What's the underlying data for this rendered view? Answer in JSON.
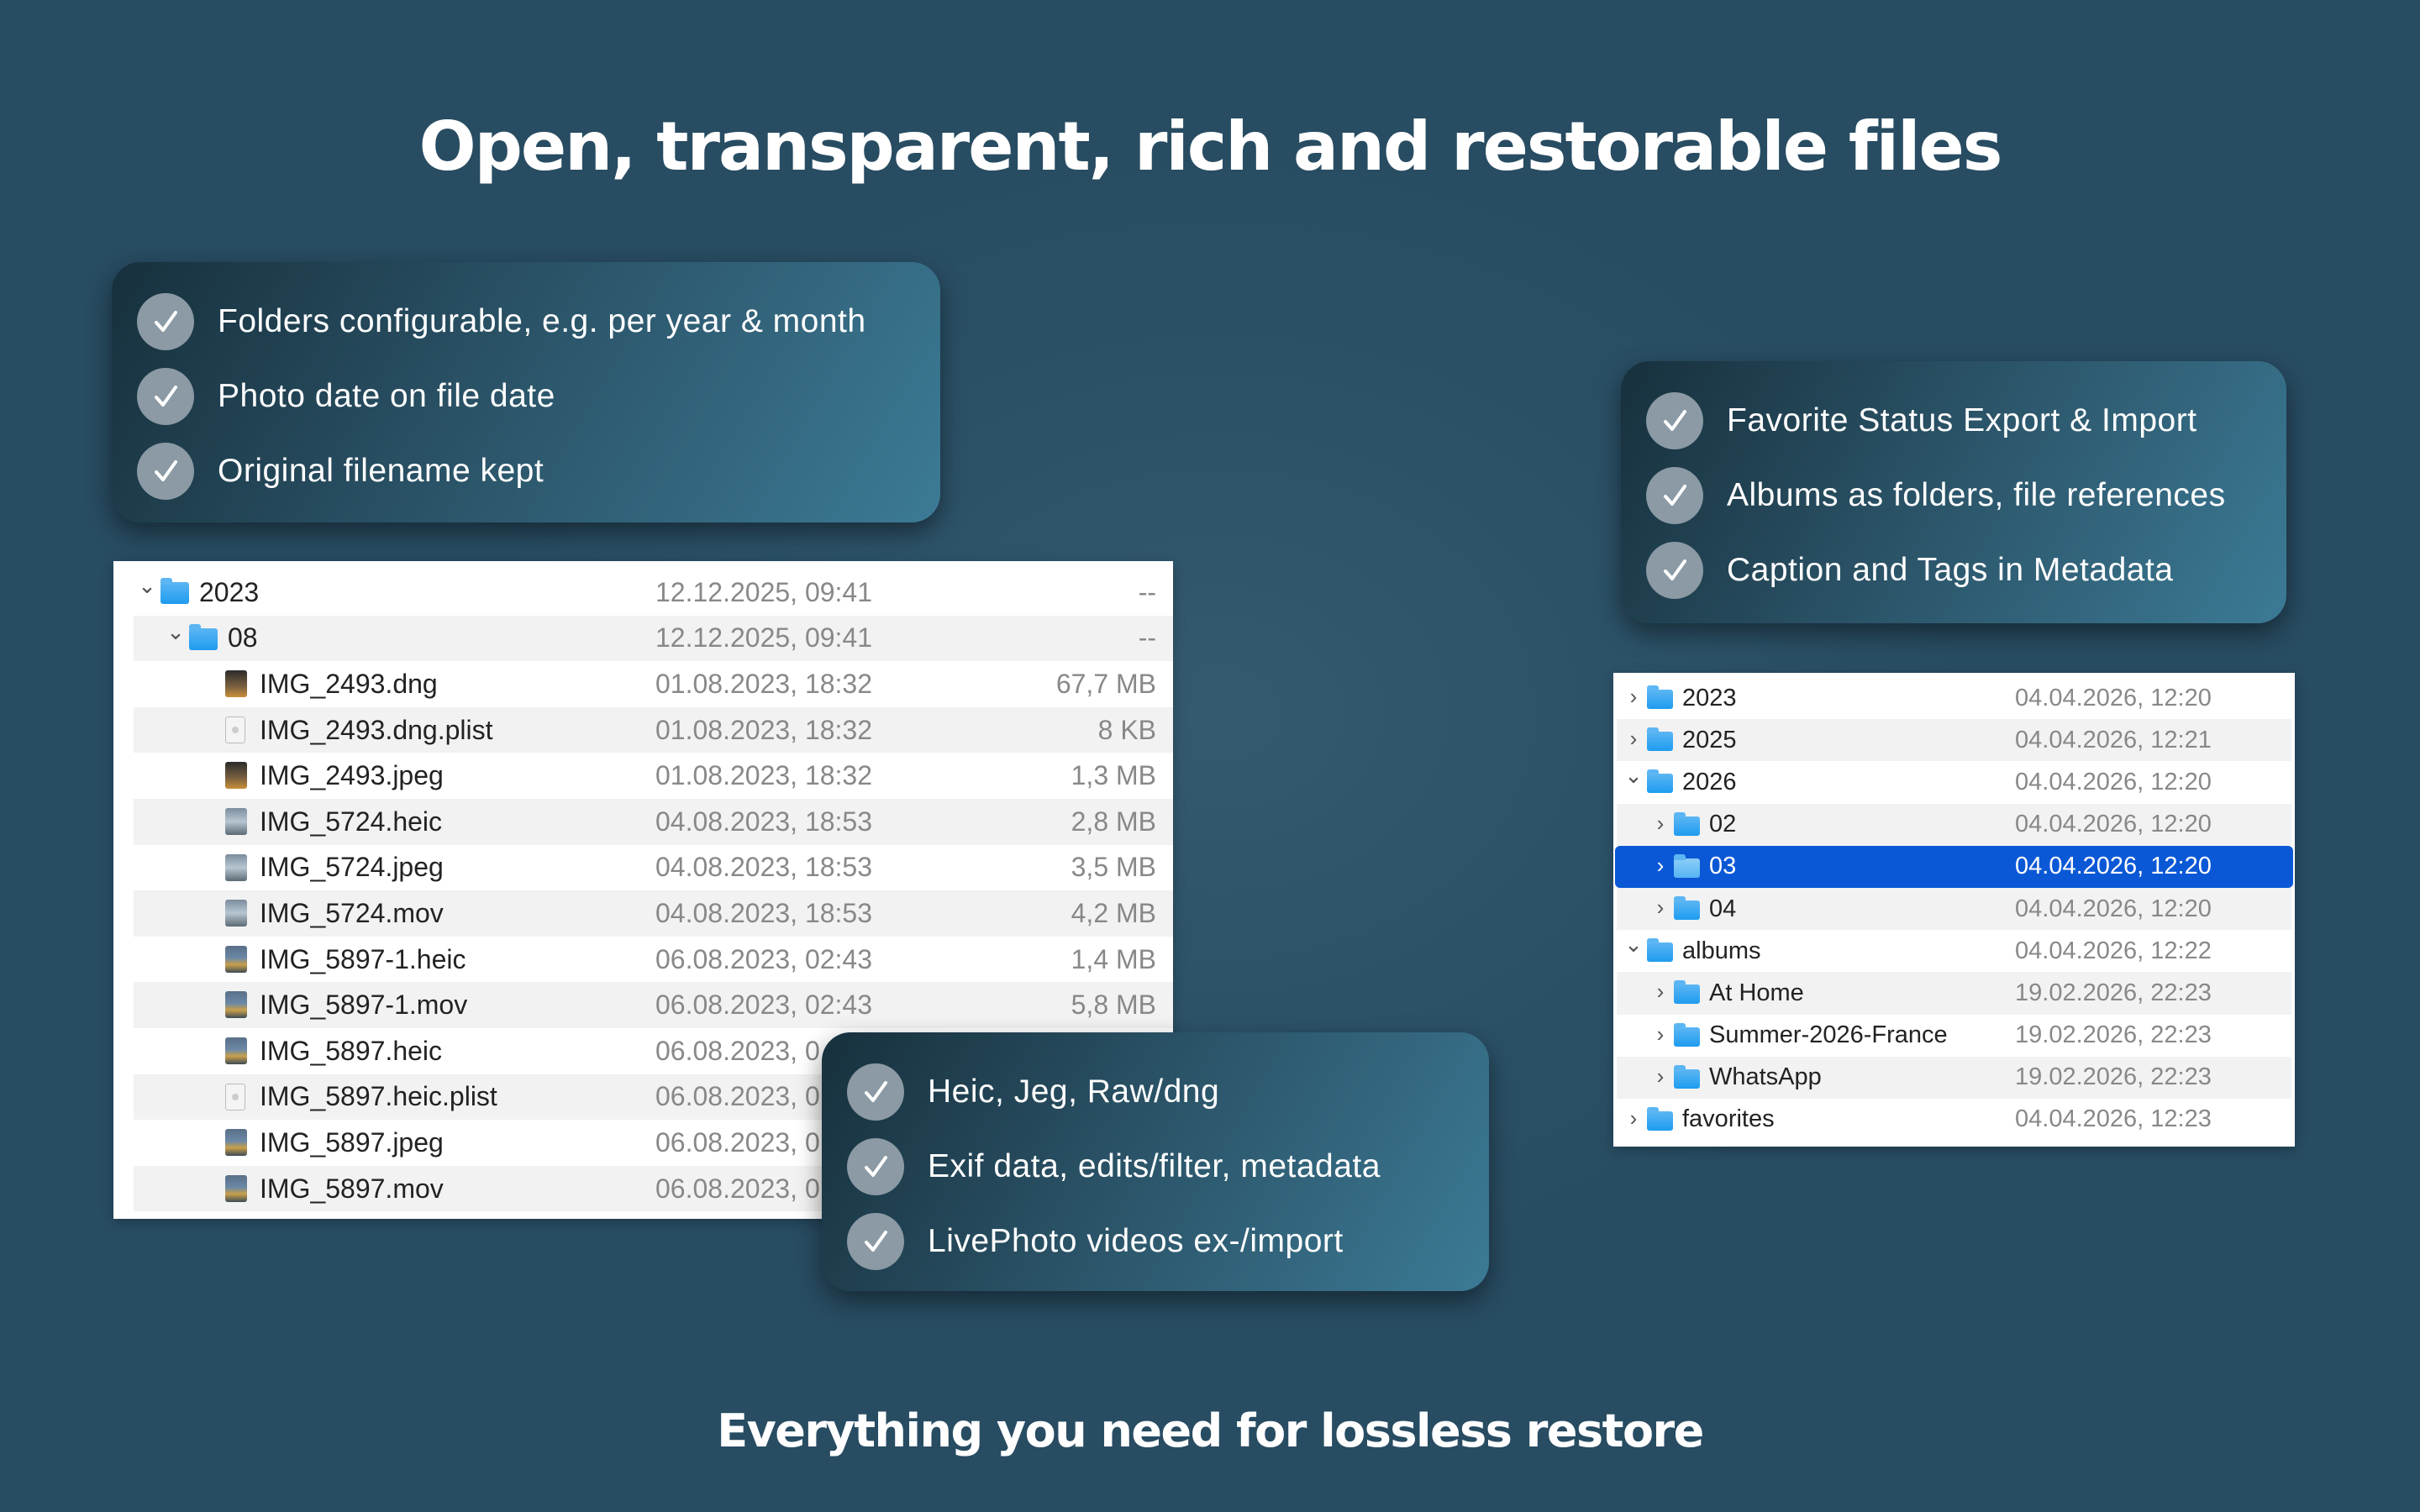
{
  "title": "Open, transparent, rich and restorable files",
  "subtitle": "Everything you need for lossless restore",
  "features_top_left": [
    "Folders configurable, e.g. per year & month",
    "Photo date on file date",
    "Original filename kept"
  ],
  "features_top_right": [
    "Favorite Status Export & Import",
    "Albums as folders, file references",
    "Caption and Tags in Metadata"
  ],
  "features_bottom_mid": [
    "Heic, Jeg, Raw/dng",
    " Exif data, edits/filter, metadata",
    "LivePhoto videos ex-/import"
  ],
  "finder_left": {
    "rows": [
      {
        "name": "2023",
        "date": "12.12.2025, 09:41",
        "size": "--",
        "kind": "folder",
        "depth": 0,
        "expanded": true
      },
      {
        "name": "08",
        "date": "12.12.2025, 09:41",
        "size": "--",
        "kind": "folder",
        "depth": 1,
        "expanded": true
      },
      {
        "name": "IMG_2493.dng",
        "date": "01.08.2023, 18:32",
        "size": "67,7 MB",
        "kind": "raw",
        "depth": 2
      },
      {
        "name": "IMG_2493.dng.plist",
        "date": "01.08.2023, 18:32",
        "size": "8 KB",
        "kind": "plist",
        "depth": 2
      },
      {
        "name": "IMG_2493.jpeg",
        "date": "01.08.2023, 18:32",
        "size": "1,3 MB",
        "kind": "raw",
        "depth": 2
      },
      {
        "name": "IMG_5724.heic",
        "date": "04.08.2023, 18:53",
        "size": "2,8 MB",
        "kind": "live",
        "depth": 2
      },
      {
        "name": "IMG_5724.jpeg",
        "date": "04.08.2023, 18:53",
        "size": "3,5 MB",
        "kind": "live",
        "depth": 2
      },
      {
        "name": "IMG_5724.mov",
        "date": "04.08.2023, 18:53",
        "size": "4,2 MB",
        "kind": "live",
        "depth": 2
      },
      {
        "name": "IMG_5897-1.heic",
        "date": "06.08.2023, 02:43",
        "size": "1,4 MB",
        "kind": "photo",
        "depth": 2
      },
      {
        "name": "IMG_5897-1.mov",
        "date": "06.08.2023, 02:43",
        "size": "5,8 MB",
        "kind": "photo",
        "depth": 2
      },
      {
        "name": "IMG_5897.heic",
        "date": "06.08.2023, 0",
        "size": "",
        "kind": "photo",
        "depth": 2
      },
      {
        "name": "IMG_5897.heic.plist",
        "date": "06.08.2023, 0",
        "size": "",
        "kind": "plist",
        "depth": 2
      },
      {
        "name": "IMG_5897.jpeg",
        "date": "06.08.2023, 0",
        "size": "",
        "kind": "photo",
        "depth": 2
      },
      {
        "name": "IMG_5897.mov",
        "date": "06.08.2023, 0",
        "size": "",
        "kind": "photo",
        "depth": 2
      }
    ]
  },
  "finder_right": {
    "rows": [
      {
        "name": "2023",
        "date": "04.04.2026, 12:20",
        "depth": 0,
        "expanded": false
      },
      {
        "name": "2025",
        "date": "04.04.2026, 12:21",
        "depth": 0,
        "expanded": false
      },
      {
        "name": "2026",
        "date": "04.04.2026, 12:20",
        "depth": 0,
        "expanded": true
      },
      {
        "name": "02",
        "date": "04.04.2026, 12:20",
        "depth": 1,
        "expanded": false
      },
      {
        "name": "03",
        "date": "04.04.2026, 12:20",
        "depth": 1,
        "expanded": false,
        "selected": true
      },
      {
        "name": "04",
        "date": "04.04.2026, 12:20",
        "depth": 1,
        "expanded": false
      },
      {
        "name": "albums",
        "date": "04.04.2026, 12:22",
        "depth": 0,
        "expanded": true
      },
      {
        "name": "At Home",
        "date": "19.02.2026, 22:23",
        "depth": 1,
        "expanded": false
      },
      {
        "name": "Summer-2026-France",
        "date": "19.02.2026, 22:23",
        "depth": 1,
        "expanded": false
      },
      {
        "name": "WhatsApp",
        "date": "19.02.2026, 22:23",
        "depth": 1,
        "expanded": false
      },
      {
        "name": "favorites",
        "date": "04.04.2026, 12:23",
        "depth": 0,
        "expanded": false
      }
    ]
  },
  "colors": {
    "background": "#2d5369",
    "selection": "#0a58d6",
    "folder": "#1e9cf0",
    "check_circle": "#8b9aa4"
  }
}
